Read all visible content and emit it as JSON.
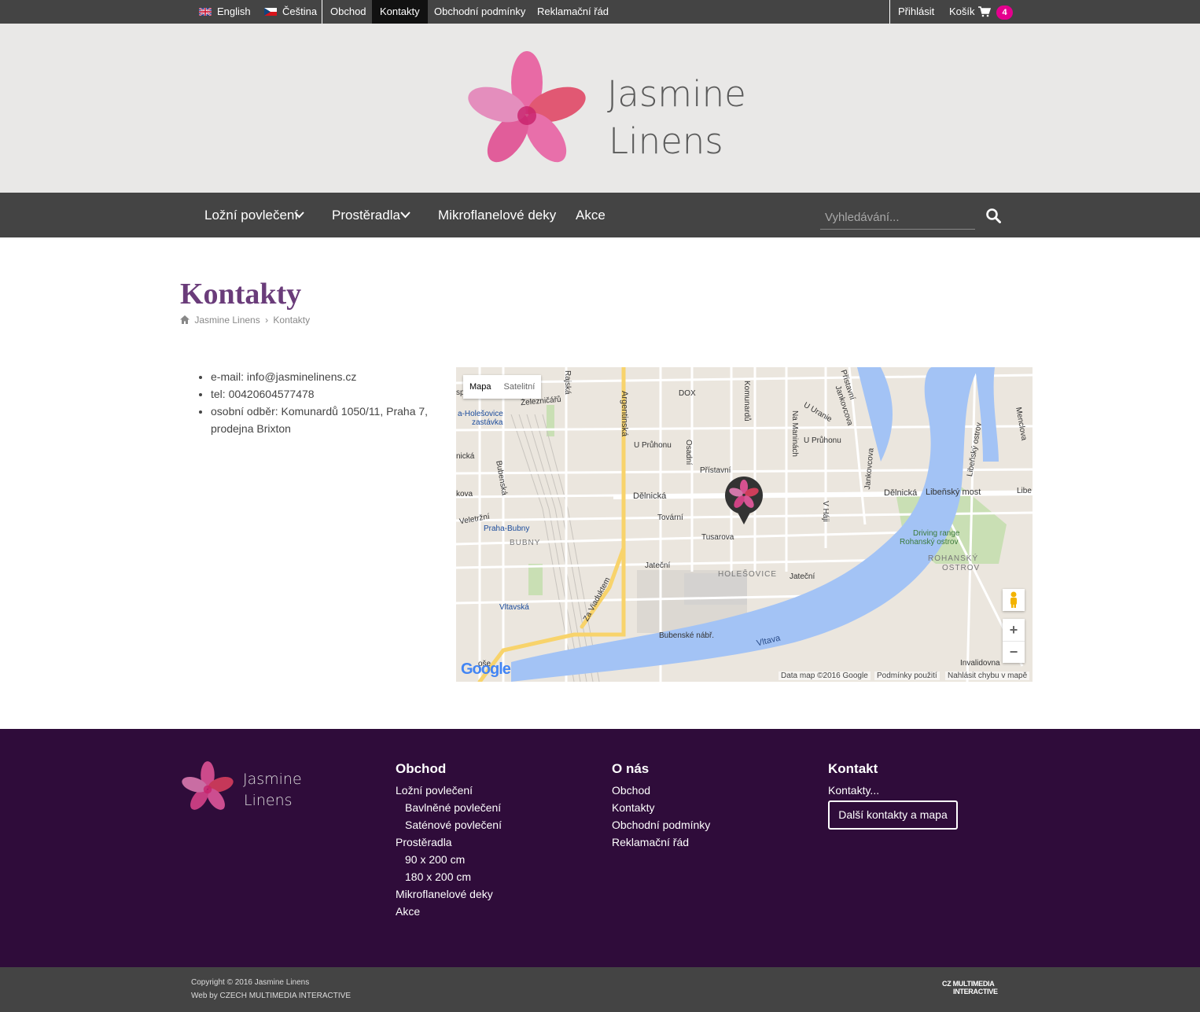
{
  "topbar": {
    "lang_en": "English",
    "lang_cs": "Čeština",
    "links": [
      "Obchod",
      "Kontakty",
      "Obchodní podmínky",
      "Reklamační řád"
    ],
    "login": "Přihlásit",
    "cart": "Košík",
    "cart_count": "4"
  },
  "brand": {
    "line1": "Jasmine",
    "line2": "Linens"
  },
  "nav": {
    "items": [
      "Ložní povlečení",
      "Prostěradla",
      "Mikroflanelové deky",
      "Akce"
    ],
    "search_placeholder": "Vyhledávání..."
  },
  "page": {
    "title": "Kontakty",
    "breadcrumb": [
      "Jasmine Linens",
      "Kontakty"
    ]
  },
  "contact": {
    "email": "e-mail: info@jasminelinens.cz",
    "tel": "tel: 00420604577478",
    "pickup_line1": "osobní odběr: Komunardů 1050/11, Praha 7,",
    "pickup_line2": "prodejna Brixton"
  },
  "map": {
    "type_map": "Mapa",
    "type_sat": "Satelitní",
    "zoom_in": "+",
    "zoom_out": "−",
    "google": "Google",
    "attr_data": "Data map ©2016 Google",
    "attr_terms": "Podmínky použití",
    "attr_report": "Nahlásit chybu v mapě",
    "labels": {
      "argentinska": "Argentinská",
      "delnicka": "Dělnická",
      "delnicka2": "Dělnická",
      "tovarni": "Tovární",
      "tusarova": "Tusarova",
      "jatecni": "Jateční",
      "jatecni2": "Jateční",
      "holesovice": "HOLEŠOVICE",
      "bubny": "BUBNY",
      "praha_bubny": "Praha-Bubny",
      "vltavska": "Vltavská",
      "vltava": "Vltava",
      "bubenske": "Bubenské nábř.",
      "za_viaduktem": "Za Viaduktem",
      "libensky": "Libeňský most",
      "rohansky": "ROHANSKÝ",
      "ostrov": "OSTROV",
      "driving": "Driving range",
      "driving2": "Rohanský ostrov",
      "prumyslova": "U Průhonu",
      "prumyslova2": "U Průhonu",
      "pristavni": "Přístavní",
      "osadni": "Osadní",
      "dox": "DOX",
      "komunardu": "Komunardů",
      "uranie": "U Uranie",
      "invalidovna": "Invalidovna",
      "holesovice_zast": "a-Holešovice",
      "zastavka": "zastávka",
      "zelezniceru": "Železničářů",
      "bubenska": "Bubenská",
      "veletrzni": "Veletržní",
      "jankovcova": "Jankovcova",
      "vhaji": "V Háji",
      "na_manich": "Na Maninách",
      "pristavni2": "Přístavní",
      "jankovcova2": "Jankovcova",
      "libensky_ostrov": "Libeňský ostrov",
      "menclova": "Menclova",
      "rajska": "Rajská",
      "nicka": "nická",
      "kova": "kova",
      "libe": "Libe",
      "sp": "sp",
      "gose": "oše"
    }
  },
  "footer": {
    "brand_line1": "Jasmine",
    "brand_line2": "Linens",
    "col1_head": "Obchod",
    "col1": [
      "Ložní povlečení",
      "Bavlněné povlečení",
      "Saténové povlečení",
      "Prostěradla",
      "90 x 200 cm",
      "180 x 200 cm",
      "Mikroflanelové deky",
      "Akce"
    ],
    "col2_head": "O nás",
    "col2": [
      "Obchod",
      "Kontakty",
      "Obchodní podmínky",
      "Reklamační řád"
    ],
    "col3_head": "Kontakt",
    "col3_link": "Kontakty...",
    "col3_button": "Další kontakty a mapa"
  },
  "bottom": {
    "copyright": "Copyright © 2016 Jasmine Linens",
    "webby": "Web by CZECH MULTIMEDIA INTERACTIVE",
    "logo_line1": "CZ MULTIMEDIA",
    "logo_line2": "INTERACTIVE"
  },
  "colors": {
    "dark_bar": "#444444",
    "header_bg": "#e9e8e7",
    "footer_bg": "#2f0c3a",
    "title": "#6a3c7a",
    "badge": "#e5008e",
    "river": "#a3c3f5"
  }
}
